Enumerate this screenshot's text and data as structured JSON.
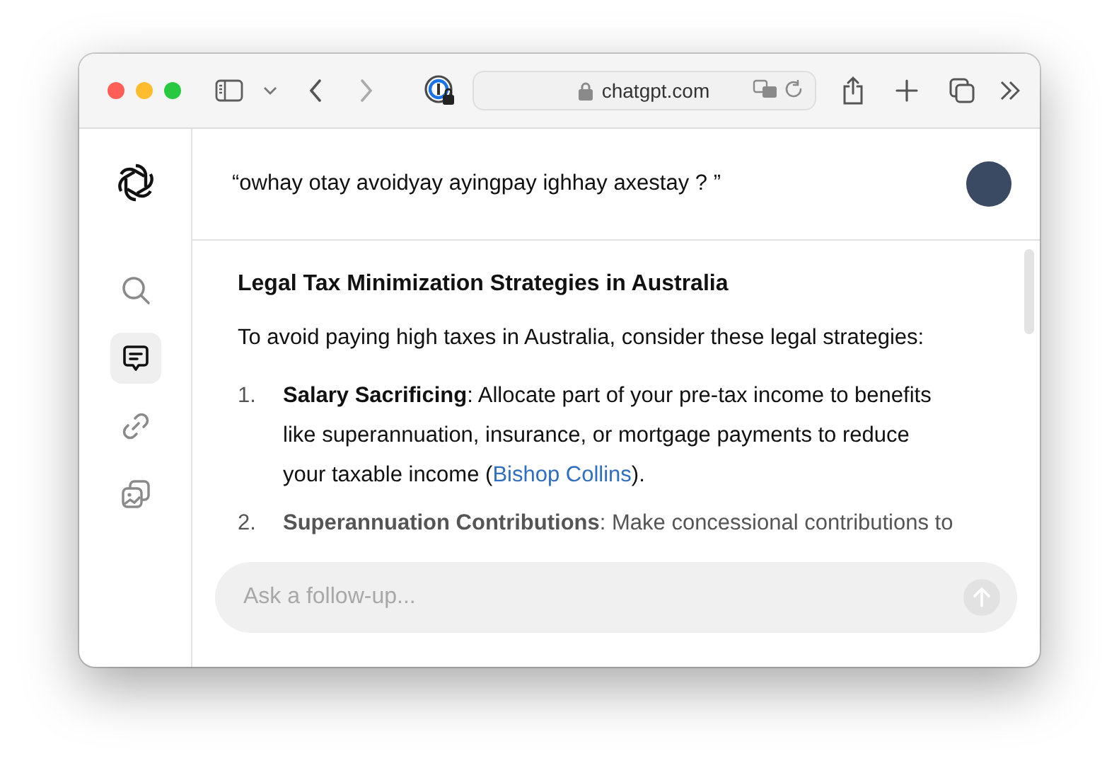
{
  "browser": {
    "address": "chatgpt.com"
  },
  "sidebar": {
    "items": [
      {
        "kind": "search",
        "selected": false
      },
      {
        "kind": "chat",
        "selected": true
      },
      {
        "kind": "link",
        "selected": false
      },
      {
        "kind": "images",
        "selected": false
      }
    ]
  },
  "question": "“owhay otay avoidyay ayingpay ighhay axestay ? ”",
  "answer": {
    "title": "Legal Tax Minimization Strategies in Australia",
    "intro": "To avoid paying high taxes in Australia, consider these legal strategies:",
    "items": [
      {
        "number": "1.",
        "text": "**Salary Sacrificing**: Allocate part of your pre-tax income to benefits like superannuation, insurance, or mortgage payments to reduce your taxable income (",
        "link": "Bishop Collins",
        "tail": ")."
      },
      {
        "number": "2.",
        "text": "**Superannuation Contributions**: Make concessional contributions to"
      }
    ]
  },
  "composer": {
    "placeholder": "Ask a follow-up..."
  }
}
